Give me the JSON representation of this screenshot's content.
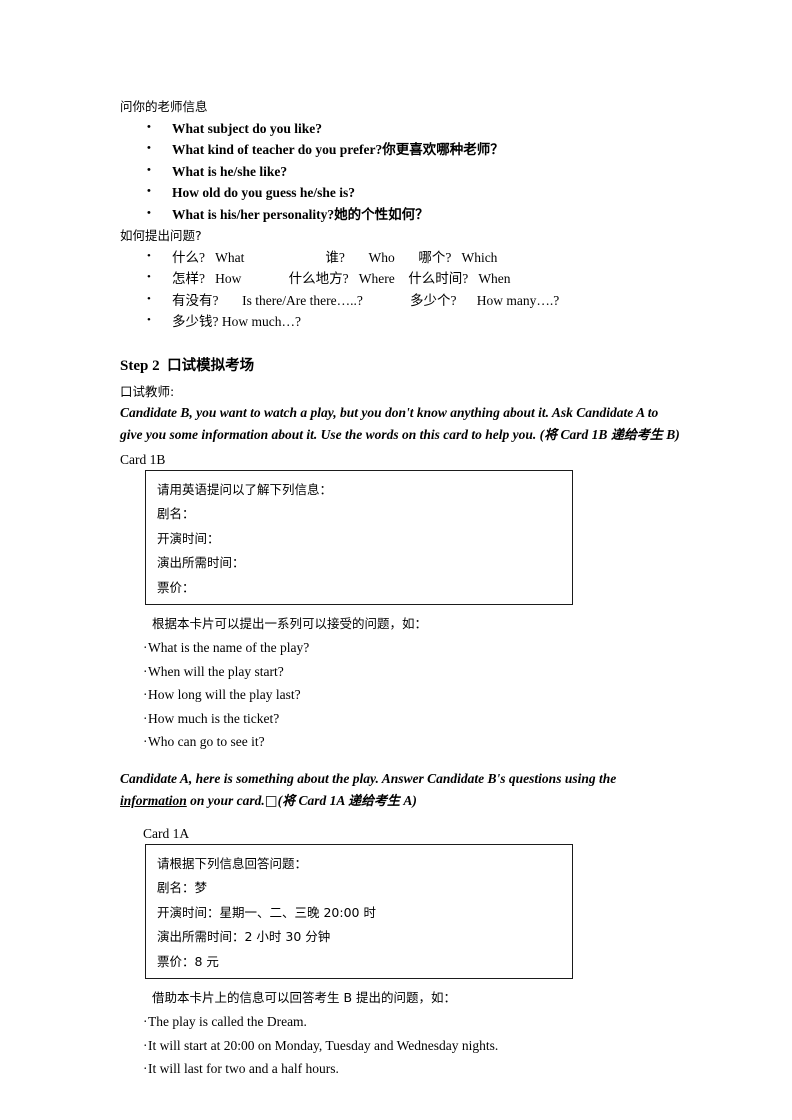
{
  "document": {
    "section_teacher_info": {
      "heading": "问你的老师信息",
      "questions": [
        "What subject do you like?",
        "What kind of teacher do you prefer?你更喜欢哪种老师？",
        "What is he/she like?",
        "How old do you guess he/she is?",
        "What is his/her personality?她的个性如何？"
      ]
    },
    "section_how_to_ask": {
      "heading": "如何提出问题?",
      "rows": [
        "什么?   What                        谁?       Who       哪个?   Which",
        "怎样?   How              什么地方?   Where    什么时间?   When",
        "有没有?       Is there/Are there…..?              多少个?      How many….?",
        "多少钱? How much…?"
      ]
    },
    "step2": {
      "heading_en": "Step 2",
      "heading_zh": "口试模拟考场",
      "teacher_label": "口试教师:",
      "instruction_b_part1": "Candidate B, you want to watch a play, but you don't know anything about it. Ask Candidate A to give you some information about it. Use the words on this card to help you. (",
      "instruction_b_zh1": "将",
      "instruction_b_mid": " Card 1B  ",
      "instruction_b_zh2": "递给考生",
      "instruction_b_end": " B)",
      "card_1b_label": "Card 1B",
      "card_1b_rows": [
        "请用英语提问以了解下列信息：",
        "剧名：",
        "开演时间：",
        "演出所需时间：",
        "票价："
      ],
      "card_1b_note": "根据本卡片可以提出一系列可以接受的问题，如：",
      "card_1b_questions": [
        "What is the name of the play?",
        "When will the play start?",
        "How long will the play last?",
        "How much is the ticket?",
        "Who can go to see it?"
      ],
      "instruction_a_underlined": "information",
      "instruction_a_part1": "Candidate A, here is something about the play. Answer Candidate B's questions using the ",
      "instruction_a_part2": " on your card.",
      "instruction_a_boxglyph": "□",
      "instruction_a_part3": "(",
      "instruction_a_zh1": "将",
      "instruction_a_mid": " Card 1A ",
      "instruction_a_zh2": "递给考生",
      "instruction_a_end": " A)",
      "card_1a_label": "Card 1A",
      "card_1a_rows": [
        "请根据下列信息回答问题：",
        "剧名：梦",
        "开演时间：星期一、二、三晚 20:00 时",
        "演出所需时间：2 小时 30 分钟",
        "票价：8 元"
      ],
      "card_1a_note": "借助本卡片上的信息可以回答考生 B 提出的问题，如：",
      "card_1a_answers": [
        "The play is called the Dream.",
        "It will start at 20:00 on Monday, Tuesday and Wednesday nights.",
        "It will last for two and a half hours."
      ]
    }
  }
}
